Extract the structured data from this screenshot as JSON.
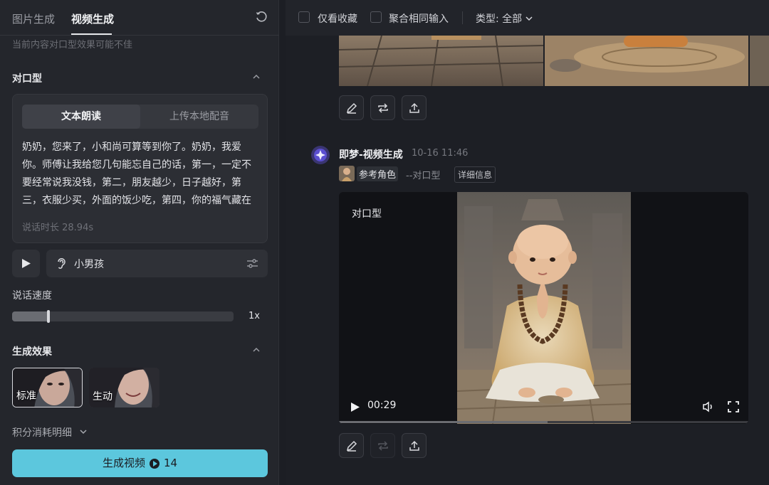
{
  "tabs": [
    {
      "label": "图片生成",
      "active": false
    },
    {
      "label": "视频生成",
      "active": true
    }
  ],
  "hint": "当前内容对口型效果可能不佳",
  "lipsync": {
    "title": "对口型",
    "modes": [
      {
        "label": "文本朗读",
        "active": true
      },
      {
        "label": "上传本地配音",
        "active": false
      }
    ],
    "script": "奶奶，您来了，小和尚可算等到你了。奶奶，我爱你。师傅让我给您几句能忘自己的话，第一，一定不要经常说我没钱，第二，朋友越少，日子越好，第三，衣服少买，外面的饭少吃，第四，你的福气藏在你的脾气里，如果您觉得对你有帮助的话，给小和尚",
    "duration": "说话时长 28.94s",
    "voice": "小男孩"
  },
  "speed": {
    "label": "说话速度",
    "value": "1x",
    "level": 0.165
  },
  "effect": {
    "title": "生成效果",
    "options": [
      {
        "label": "标准",
        "selected": true
      },
      {
        "label": "生动",
        "selected": false
      }
    ]
  },
  "points_detail": "积分消耗明细",
  "generate": {
    "label": "生成视频",
    "cost": "14"
  },
  "filters": {
    "favorites_only": "仅看收藏",
    "merge_inputs": "聚合相同输入",
    "type_label": "类型: 全部"
  },
  "record": {
    "title": "即梦-视频生成",
    "date": "10-16",
    "time": "11:46",
    "ref_role": "参考角色",
    "mode": "--对口型",
    "detail": "详细信息"
  },
  "video": {
    "tag": "对口型",
    "time": "00:29",
    "progress": 0.51
  },
  "colors": {
    "accent": "#5cc7dd",
    "panel": "#24262c",
    "background": "#1d1f25"
  },
  "icons": {
    "reset": "refresh-icon",
    "edit": "pencil-icon",
    "regenerate": "repeat-icon",
    "export": "upload-icon",
    "voice": "ear-icon",
    "voice_settings": "sliders-icon",
    "volume": "volume-icon",
    "fullscreen": "fullscreen-icon"
  }
}
